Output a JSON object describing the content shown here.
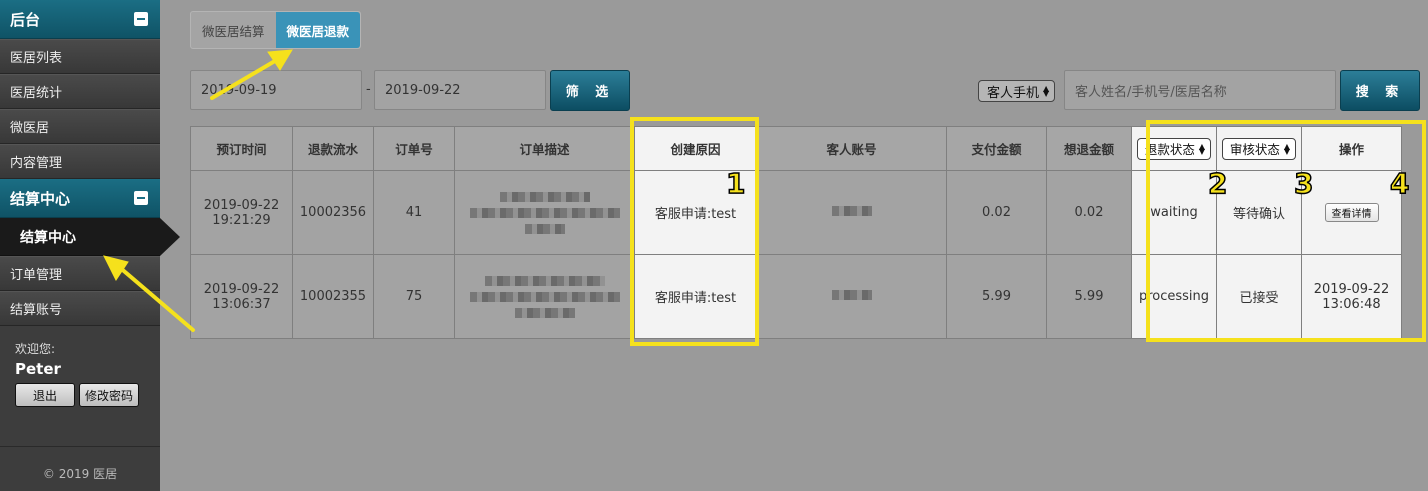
{
  "sidebar": {
    "section1_title": "后台",
    "items1": [
      "医居列表",
      "医居统计",
      "微医居",
      "内容管理"
    ],
    "section2_title": "结算中心",
    "active_item": "结算中心",
    "items2": [
      "订单管理",
      "结算账号"
    ],
    "welcome_label": "欢迎您:",
    "username": "Peter",
    "logout_label": "退出",
    "change_password_label": "修改密码",
    "copyright": "© 2019 医居"
  },
  "tabs": [
    {
      "label": "微医居结算",
      "active": false
    },
    {
      "label": "微医居退款",
      "active": true
    }
  ],
  "filter": {
    "date_start": "2019-09-19",
    "date_separator": "-",
    "date_end": "2019-09-22",
    "filter_button": "筛 选",
    "search_type_selected": "客人手机",
    "search_placeholder": "客人姓名/手机号/医居名称",
    "search_button": "搜 索"
  },
  "table": {
    "headers": [
      "预订时间",
      "退款流水",
      "订单号",
      "订单描述",
      "创建原因",
      "客人账号",
      "支付金额",
      "想退金额",
      "退款状态",
      "审核状态",
      "操作"
    ],
    "rows": [
      {
        "booking_date": "2019-09-22",
        "booking_time": "19:21:29",
        "refund_serial": "10002356",
        "order_no": "41",
        "reason": "客服申请:test",
        "pay_amount": "0.02",
        "refund_amount": "0.02",
        "refund_status": "waiting",
        "review_status": "等待确认",
        "action": "查看详情"
      },
      {
        "booking_date": "2019-09-22",
        "booking_time": "13:06:37",
        "refund_serial": "10002355",
        "order_no": "75",
        "reason": "客服申请:test",
        "pay_amount": "5.99",
        "refund_amount": "5.99",
        "refund_status": "processing",
        "review_status": "已接受",
        "action_date": "2019-09-22",
        "action_time": "13:06:48"
      }
    ]
  },
  "annotations": {
    "labels": [
      "1",
      "2",
      "3",
      "4"
    ],
    "color": "#f5e11c"
  },
  "colors": {
    "accent": "#1b6e84",
    "active_tab": "#3a93b8",
    "pending_red": "#d21f2a"
  }
}
